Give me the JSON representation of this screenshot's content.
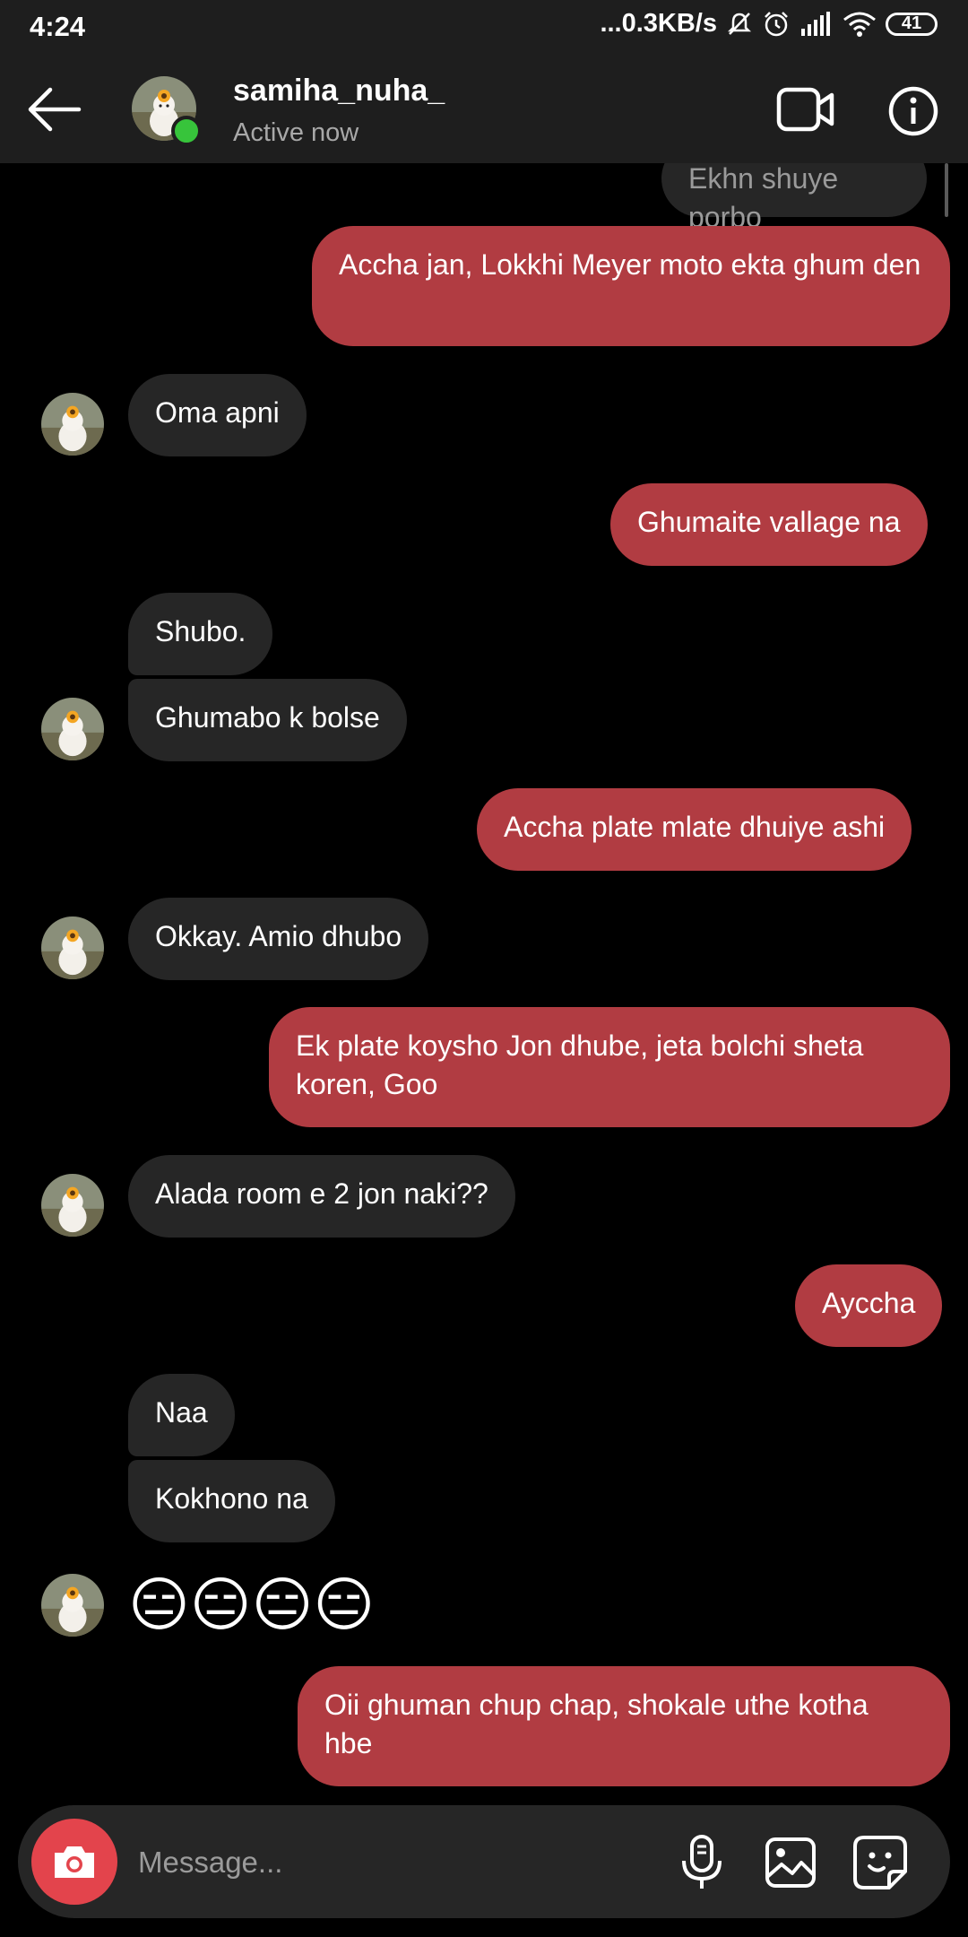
{
  "status_bar": {
    "time": "4:24",
    "network_speed": "...0.3KB/s",
    "battery": "41",
    "icons": [
      "mute-icon",
      "alarm-icon",
      "signal-icon",
      "wifi-icon",
      "battery-icon"
    ]
  },
  "header": {
    "username": "samiha_nuha_",
    "activity": "Active now",
    "icons": [
      "back-arrow-icon",
      "video-call-icon",
      "info-icon"
    ]
  },
  "messages": [
    {
      "side": "in",
      "text": "Ekhn shuye porbo"
    },
    {
      "side": "out",
      "text": "Accha jan, Lokkhi Meyer moto ekta ghum den"
    },
    {
      "side": "in",
      "text": "Oma apni"
    },
    {
      "side": "out",
      "text": "Ghumaite vallage na"
    },
    {
      "side": "in",
      "text": "Shubo."
    },
    {
      "side": "in",
      "text": "Ghumabo k bolse"
    },
    {
      "side": "out",
      "text": "Accha plate mlate dhuiye ashi"
    },
    {
      "side": "in",
      "text": "Okkay. Amio dhubo"
    },
    {
      "side": "out",
      "text": "Ek plate koysho Jon dhube, jeta bolchi sheta koren, Goo"
    },
    {
      "side": "in",
      "text": "Alada room e 2 jon naki??"
    },
    {
      "side": "out",
      "text": "Ayccha"
    },
    {
      "side": "in",
      "text": "Naa"
    },
    {
      "side": "in",
      "text": "Kokhono na"
    },
    {
      "side": "in",
      "text": "😑😑😑😑"
    },
    {
      "side": "out",
      "text": "Oii ghuman chup chap, shokale uthe kotha hbe"
    }
  ],
  "composer": {
    "placeholder": "Message...",
    "icons": [
      "camera-icon",
      "microphone-icon",
      "gallery-icon",
      "sticker-icon"
    ]
  },
  "colors": {
    "outgoing_bubble": "#b13c42",
    "incoming_bubble": "#262626",
    "header_background": "#1e1e1e",
    "camera_button": "#e3444c",
    "online_dot": "#37c43b"
  }
}
